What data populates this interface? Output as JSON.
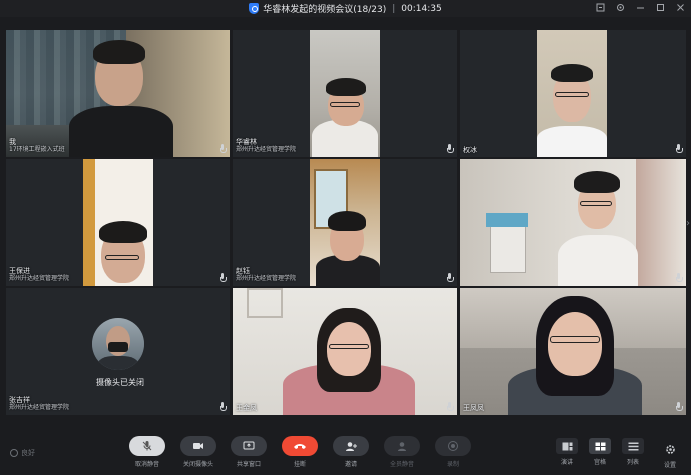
{
  "window": {
    "title": "华睿林发起的视频会议(18/23)",
    "separator": "|",
    "timer": "00:14:35",
    "controls": [
      "pin-icon",
      "settings-icon",
      "minimize-icon",
      "maximize-icon",
      "close-icon"
    ]
  },
  "tiles": [
    {
      "name": "我",
      "org": "17环境工程嵌入式班",
      "camera": true
    },
    {
      "name": "华睿林",
      "org": "郑州升达经贸管理学院",
      "camera": true
    },
    {
      "name": "权冰",
      "org": "",
      "camera": true
    },
    {
      "name": "王保进",
      "org": "郑州升达经贸管理学院",
      "camera": true
    },
    {
      "name": "赵钰",
      "org": "郑州升达经贸管理学院",
      "camera": true
    },
    {
      "name": "",
      "org": "",
      "camera": true
    },
    {
      "name": "张吉祥",
      "org": "郑州升达经贸管理学院",
      "camera": false,
      "status": "摄像头已关闭"
    },
    {
      "name": "王金凤",
      "org": "",
      "camera": true
    },
    {
      "name": "王凤凤",
      "org": "",
      "camera": true
    }
  ],
  "toolbar": {
    "signal_label": "良好",
    "buttons": [
      {
        "label": "取消静音",
        "icon": "mic-muted-icon",
        "state": "active"
      },
      {
        "label": "关闭摄像头",
        "icon": "camera-icon",
        "state": "normal"
      },
      {
        "label": "共享窗口",
        "icon": "share-screen-icon",
        "state": "normal"
      },
      {
        "label": "挂断",
        "icon": "hang-up-icon",
        "state": "danger"
      },
      {
        "label": "邀请",
        "icon": "invite-icon",
        "state": "normal"
      },
      {
        "label": "全员静音",
        "icon": "mute-all-icon",
        "state": "disabled"
      },
      {
        "label": "录制",
        "icon": "record-icon",
        "state": "disabled"
      }
    ],
    "layouts": [
      {
        "label": "演讲",
        "icon": "speaker-layout-icon",
        "selected": false
      },
      {
        "label": "宫格",
        "icon": "grid-layout-icon",
        "selected": true
      },
      {
        "label": "列表",
        "icon": "list-layout-icon",
        "selected": false
      }
    ],
    "settings_label": "设置"
  },
  "colors": {
    "background": "#1b1c1f",
    "tile_bg": "#24272b",
    "accent_blue": "#2f7cf6",
    "hangup_red": "#f04a34"
  }
}
